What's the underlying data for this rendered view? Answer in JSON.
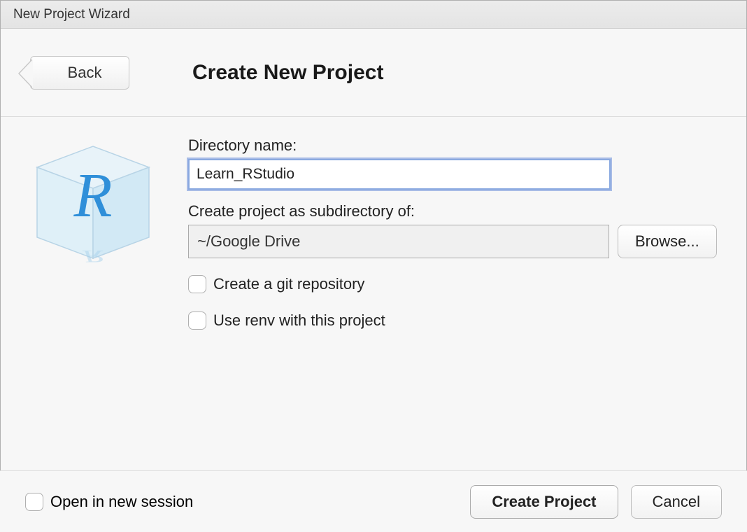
{
  "window": {
    "title": "New Project Wizard"
  },
  "header": {
    "back_label": "Back",
    "page_title": "Create New Project"
  },
  "form": {
    "dir_label": "Directory name:",
    "dir_value": "Learn_RStudio",
    "sub_label": "Create project as subdirectory of:",
    "sub_value": "~/Google Drive",
    "browse_label": "Browse...",
    "git_label": "Create a git repository",
    "renv_label": "Use renv with this project"
  },
  "footer": {
    "new_session_label": "Open in new session",
    "create_label": "Create Project",
    "cancel_label": "Cancel"
  },
  "icon": {
    "name": "r-project-cube-icon"
  }
}
